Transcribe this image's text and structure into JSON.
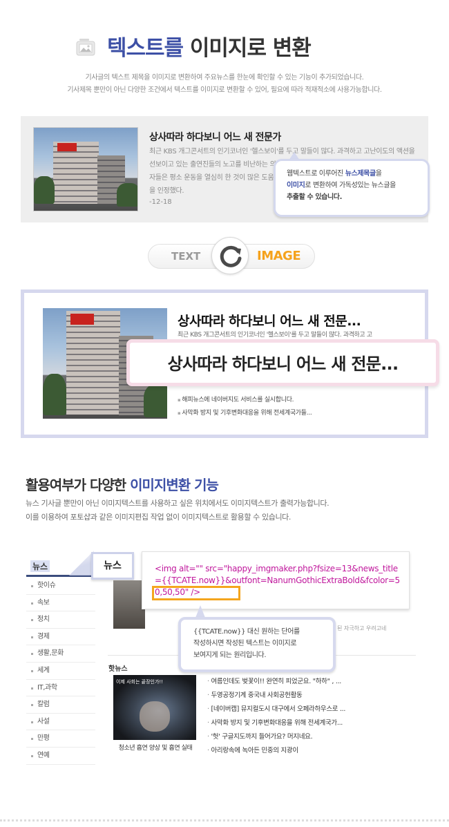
{
  "header": {
    "title_highlight": "텍스트를",
    "title_rest": "이미지로 변환",
    "icon": "picture-icon",
    "desc_line1": "기사글의 텍스트 제목을 이미지로 변환하여 주요뉴스를 한눈에 확인할 수 있는 기능이 추가되었습니다.",
    "desc_line2": "기사제목 뿐만이 아닌 다양한 조건에서 텍스트를 이미지로 변환할 수 있어, 필요에 따라 적재적소에 사용가능합니다."
  },
  "example_text": {
    "title": "상사따라 하다보니 어느 새 전문가",
    "body": "최근 KBS 개그콘서트의 인기코너인 '헬스보이'를 두고 말들이 많다. 과격하고 고난이도의 액션을 선보이고 있는 출연진들의 노고를 비난하는 의견부터 우려의 목소리까지 나오고 있는 것. 이에 출연자들은 평소 운동을 열심히 한 것이 많은 도움이 되었다고 말했다. 숙지했음은 물론 유단자 출신임을 인정했다.",
    "date": "-12-18",
    "tooltip_line1_pre": "웹텍스트로 이루어진 ",
    "tooltip_line1_hl": "뉴스제목글",
    "tooltip_line1_post": "을",
    "tooltip_line2_hl": "이미지",
    "tooltip_line2_post": "로 변환하여 가독성있는 뉴스글을",
    "tooltip_line3": "추출할 수 있습니다."
  },
  "conversion": {
    "from": "TEXT",
    "to": "IMAGE",
    "icon": "refresh-arrow-icon"
  },
  "example_image": {
    "title": "상사따라 하다보니 어느 새 전문...",
    "body": "최근 KBS 개그콘서트의 인기코너인 '헬스보이'를 두고 말들이 많다. 과격하고 고",
    "list": [
      "해피뉴스에 네이버지도 서비스를 실시합니다.",
      "사막화 방지 및 기후변화대응을 위해 전세계국가들..."
    ],
    "banner": "상사따라 하다보니 어느 새 전문..."
  },
  "section2": {
    "title_pre": "활용여부가 다양한 ",
    "title_hl": "이미지변환 기능",
    "desc_line1": "뉴스 기사글 뿐만이 아닌 이미지텍스트를 사용하고 싶은 위치에서도 이미지텍스트가 출력가능합니다.",
    "desc_line2": "이를 이용하여 포토샵과 같은 이미지편집 작업 없이 이미지텍스트로 활용할 수 있습니다."
  },
  "demo": {
    "side_title": "뉴스",
    "side_items": [
      "핫이슈",
      "속보",
      "정치",
      "경제",
      "생활,문화",
      "세계",
      "IT,과학",
      "칼럼",
      "사설",
      "만평",
      "연예"
    ],
    "tag": "뉴스",
    "code": "<img alt=\"\" src=\"happy_imgmaker.php?fsize=13&news_title={{TCATE.now}}&outfont=NanumGothicExtraBold&fcolor=50,50,50\" />",
    "tooltip_line1": "{{TCATE.now}} 대신 원하는 단어를",
    "tooltip_line2": "작성하시면 작성된 텍스트는 이미지로",
    "tooltip_line3": "보여지게 되는 원리입니다.",
    "gray_text": "된 자극하고 우려고네",
    "hotnews_label": "핫뉴스",
    "hot_img_caption": "이제 사회는 끝장인가!!",
    "hot_img_sub": "청소년 흡연 양상 및 흡연 실태",
    "hot_list": [
      "여름인데도 벚꽃이!! 완연히 피었군요. \"하하\" , ...",
      "두영공정기계 중국내 사회공헌활동",
      "[네이버캡] 뮤지컬도시 대구에서 오페라하우스로 ...",
      "사막화 방지 및 기후변화대응을 위해 전세계국가...",
      "'헛' 구글지도까지 들어가요? 머지네요.",
      "아리랑속에 녹아든 민중의 지광이"
    ]
  }
}
